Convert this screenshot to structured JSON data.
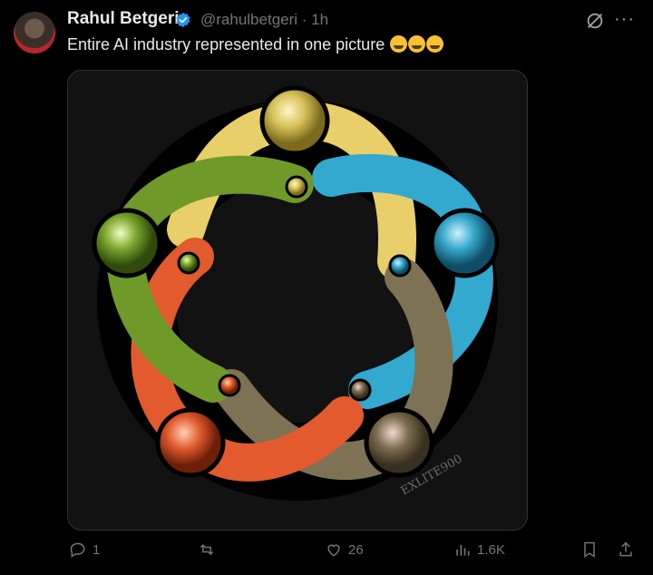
{
  "post": {
    "author_name": "Rahul Betgeri",
    "handle": "@rahulbetgeri",
    "time": "1h",
    "text": "Entire AI industry represented in one picture",
    "emojis": [
      "rolling-on-floor-laughing",
      "rolling-on-floor-laughing",
      "rolling-on-floor-laughing"
    ],
    "image_watermark": "EXLITE900"
  },
  "actions": {
    "replies": "1",
    "reposts": "",
    "likes": "26",
    "views": "1.6K"
  },
  "colors": {
    "background": "#000000",
    "verified": "#1d9bf0",
    "muted": "#71767b",
    "yellow": "#e8cf6a",
    "cyan": "#34a9cf",
    "olive": "#7d7254",
    "orange": "#e35a2e",
    "green": "#6f9a2a"
  }
}
